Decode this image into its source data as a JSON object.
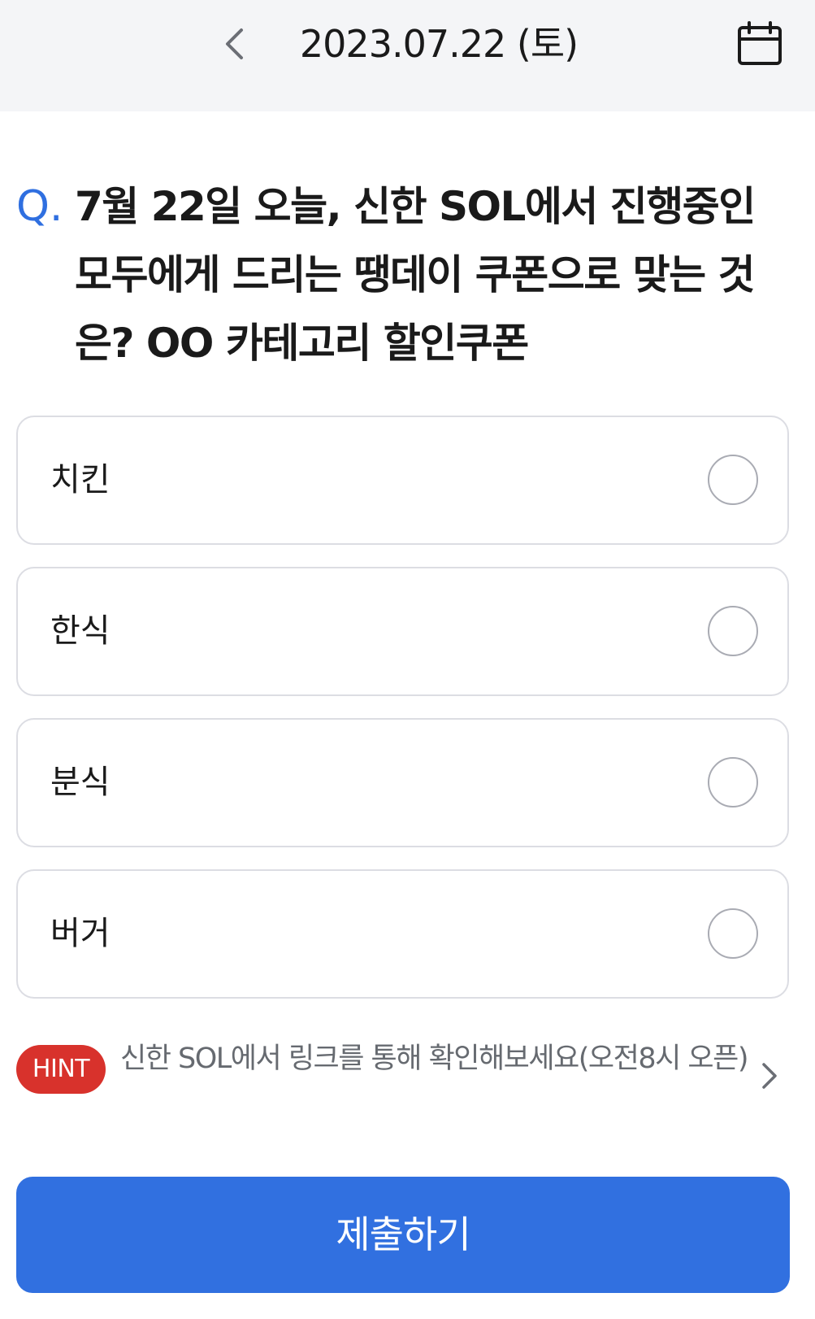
{
  "header": {
    "date": "2023.07.22 (토)",
    "back_icon": "chevron-left-icon",
    "calendar_icon": "calendar-icon"
  },
  "question": {
    "prefix": "Q.",
    "text": "7월 22일 오늘, 신한 SOL에서 진행중인 모두에게 드리는 땡데이 쿠폰으로 맞는 것은? OO 카테고리 할인쿠폰"
  },
  "options": [
    {
      "label": "치킨"
    },
    {
      "label": "한식"
    },
    {
      "label": "분식"
    },
    {
      "label": "버거"
    }
  ],
  "hint": {
    "badge": "HINT",
    "text": "신한 SOL에서 링크를 통해 확인해보세요(오전8시 오픈)"
  },
  "submit_label": "제출하기",
  "colors": {
    "accent": "#3170e0",
    "hint_badge": "#d8322c",
    "header_bg": "#f4f5f7",
    "option_border": "#dcdde3"
  }
}
